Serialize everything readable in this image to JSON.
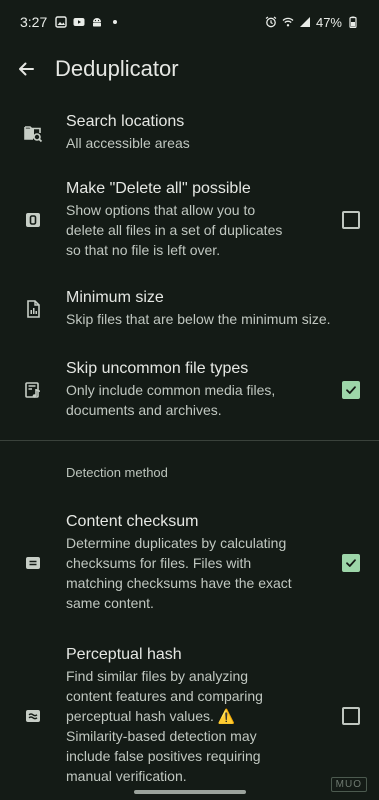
{
  "status_bar": {
    "time": "3:27",
    "battery": "47%",
    "icons_left": [
      "image-icon",
      "youtube-icon",
      "android-icon",
      "dot-icon"
    ],
    "icons_right": [
      "alarm-icon",
      "wifi-icon",
      "signal-icon",
      "battery-icon"
    ]
  },
  "toolbar": {
    "title": "Deduplicator",
    "back_icon": "back-arrow-icon"
  },
  "settings": {
    "search_locations": {
      "title": "Search locations",
      "subtitle": "All accessible areas",
      "icon": "folder-search-icon"
    },
    "delete_all": {
      "title": "Make \"Delete all\" possible",
      "subtitle": "Show options that allow you to\ndelete all files in a set of duplicates\nso that no file is left over.",
      "icon": "zero-box-icon",
      "checked": false
    },
    "minimum_size": {
      "title": "Minimum size",
      "subtitle": "Skip files that are below the minimum size.",
      "icon": "file-chart-icon"
    },
    "skip_uncommon": {
      "title": "Skip uncommon file types",
      "subtitle": "Only include common media files,\ndocuments and archives.",
      "icon": "file-music-icon",
      "checked": true
    }
  },
  "detection": {
    "header": "Detection method",
    "content_checksum": {
      "title": "Content checksum",
      "subtitle": "Determine duplicates by calculating\nchecksums for files. Files with\nmatching checksums have the exact\nsame content.",
      "icon": "equal-box-icon",
      "checked": true
    },
    "perceptual_hash": {
      "title": "Perceptual hash",
      "subtitle": "Find similar files by analyzing\ncontent features and comparing\nperceptual hash values. ⚠️\nSimilarity-based detection may\ninclude false positives requiring\nmanual verification.",
      "icon": "approx-equal-box-icon",
      "checked": false
    }
  },
  "watermark": "MUO",
  "colors": {
    "background": "#141b16",
    "accent": "#9dd6a9",
    "text_primary": "#e5e7e3",
    "text_secondary": "#c0c7c0"
  }
}
